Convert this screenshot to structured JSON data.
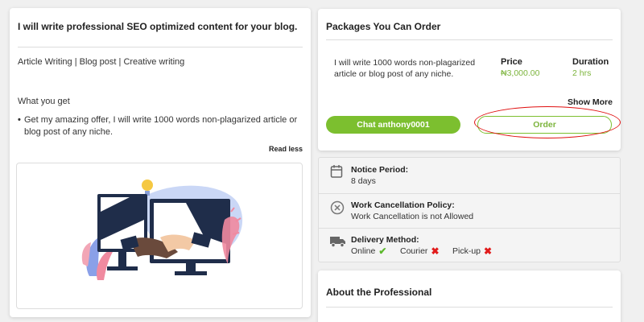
{
  "gig": {
    "title": "I will write professional SEO optimized content for your blog.",
    "tags": "Article Writing | Blog post | Creative writing",
    "what_you_get_label": "What you get",
    "bullet": "Get my amazing offer, I will write 1000 words non-plagarized article or blog post of any niche.",
    "read_less": "Read less"
  },
  "packages": {
    "title": "Packages You Can Order",
    "description": "I will write 1000 words non-plagarized article or blog post of any niche.",
    "price_label": "Price",
    "price_value": "₦3,000.00",
    "duration_label": "Duration",
    "duration_value": "2 hrs",
    "show_more": "Show More",
    "chat_button": "Chat anthony0001",
    "order_button": "Order"
  },
  "info": {
    "notice_label": "Notice Period:",
    "notice_value": "8 days",
    "cancellation_label": "Work Cancellation Policy:",
    "cancellation_value": "Work Cancellation is not Allowed",
    "delivery_label": "Delivery Method:",
    "delivery_options": [
      {
        "label": "Online",
        "available": true
      },
      {
        "label": "Courier",
        "available": false
      },
      {
        "label": "Pick-up",
        "available": false
      }
    ]
  },
  "about": {
    "title": "About the Professional"
  },
  "colors": {
    "accent_green": "#7cbf2f",
    "highlight_red": "#e01010",
    "cross_red": "#e11b1b"
  },
  "icons": [
    "calendar-icon",
    "cancel-circle-icon",
    "truck-icon",
    "check-icon",
    "cross-icon"
  ]
}
